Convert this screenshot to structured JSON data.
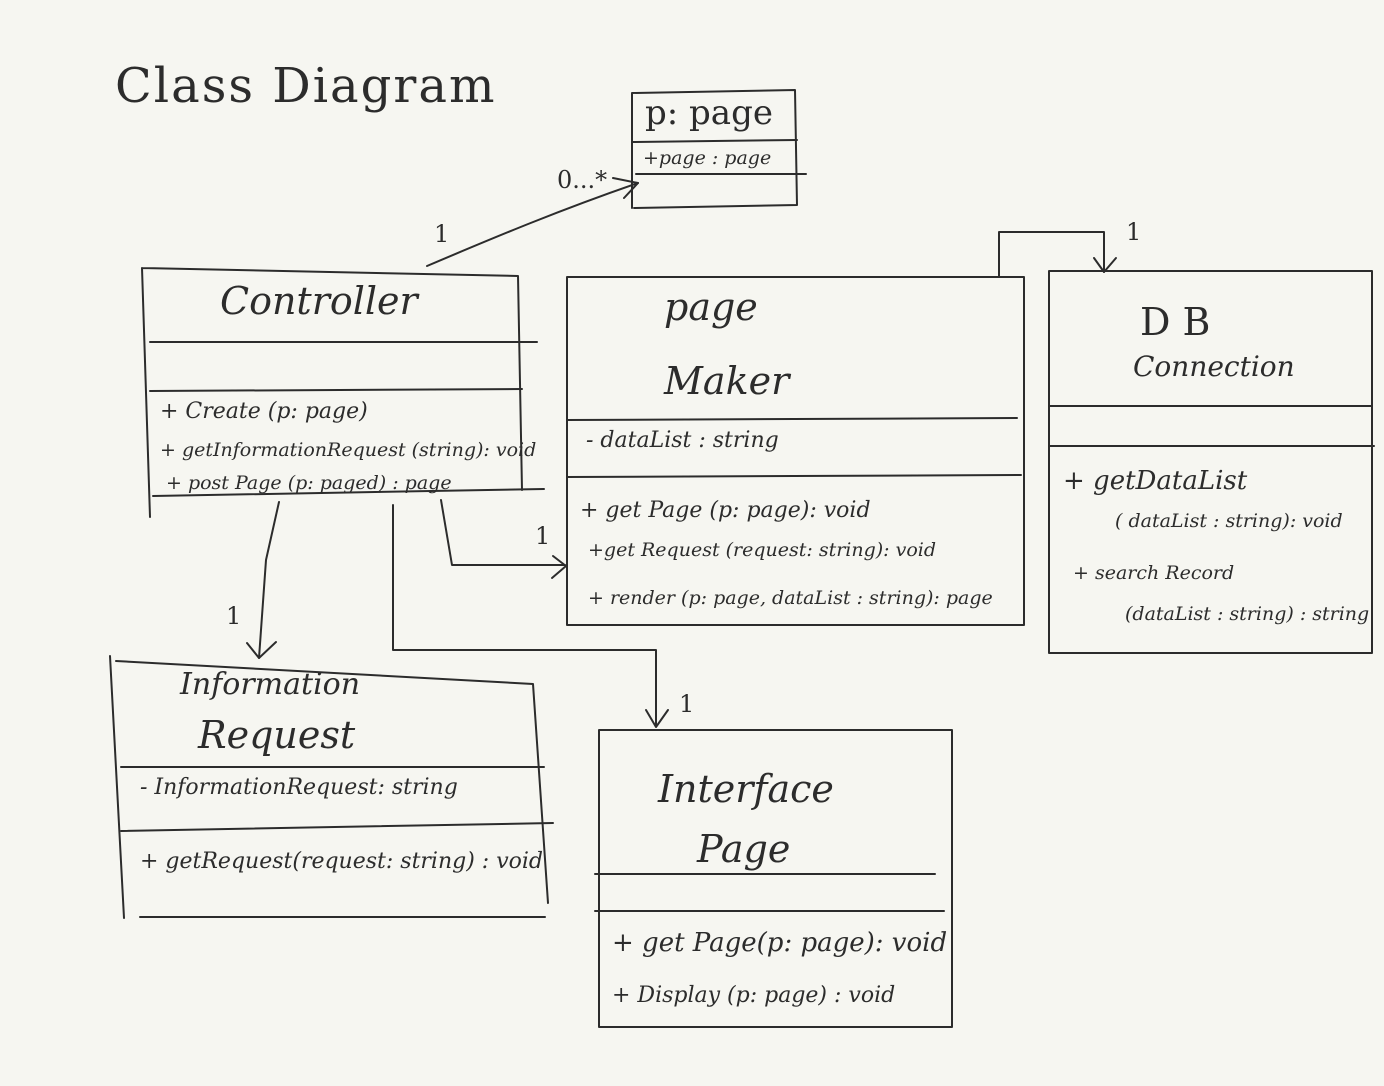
{
  "diagram": {
    "title": "Class Diagram",
    "classes": [
      {
        "id": "page",
        "name": [
          "p: page"
        ],
        "attributes": [
          "+page : page"
        ],
        "operations": []
      },
      {
        "id": "controller",
        "name": [
          "Controller"
        ],
        "attributes": [],
        "operations": [
          "+ Create (p: page)",
          "+ getInformationRequest (string): void",
          "+ post Page (p: paged) : page"
        ]
      },
      {
        "id": "page-maker",
        "name": [
          "page",
          "Maker"
        ],
        "attributes": [
          "- dataList : string"
        ],
        "operations": [
          "+ get Page (p: page): void",
          "+get Request (request: string): void",
          "+ render (p: page, dataList : string): page"
        ]
      },
      {
        "id": "db-connection",
        "name": [
          "D B",
          "Connection"
        ],
        "attributes": [],
        "operations": [
          "+ getDataList",
          "( dataList : string): void",
          "+ search Record",
          "(dataList : string) : string"
        ]
      },
      {
        "id": "information-request",
        "name": [
          "Information",
          "Request"
        ],
        "attributes": [
          "- InformationRequest: string"
        ],
        "operations": [
          "+ getRequest(request: string) : void"
        ]
      },
      {
        "id": "interface-page",
        "name": [
          "Interface",
          "Page"
        ],
        "attributes": [],
        "operations": [
          "+ get Page(p: page): void",
          "+ Display (p: page) : void"
        ]
      }
    ],
    "associations": [
      {
        "from": "controller",
        "to": "page",
        "source_multiplicity": "1",
        "target_multiplicity": "0...*"
      },
      {
        "from": "page-maker",
        "to": "db-connection",
        "target_multiplicity": "1"
      },
      {
        "from": "controller",
        "to": "page-maker",
        "target_multiplicity": "1"
      },
      {
        "from": "controller",
        "to": "information-request",
        "target_multiplicity": "1"
      },
      {
        "from": "controller",
        "to": "interface-page",
        "target_multiplicity": "1"
      }
    ]
  }
}
